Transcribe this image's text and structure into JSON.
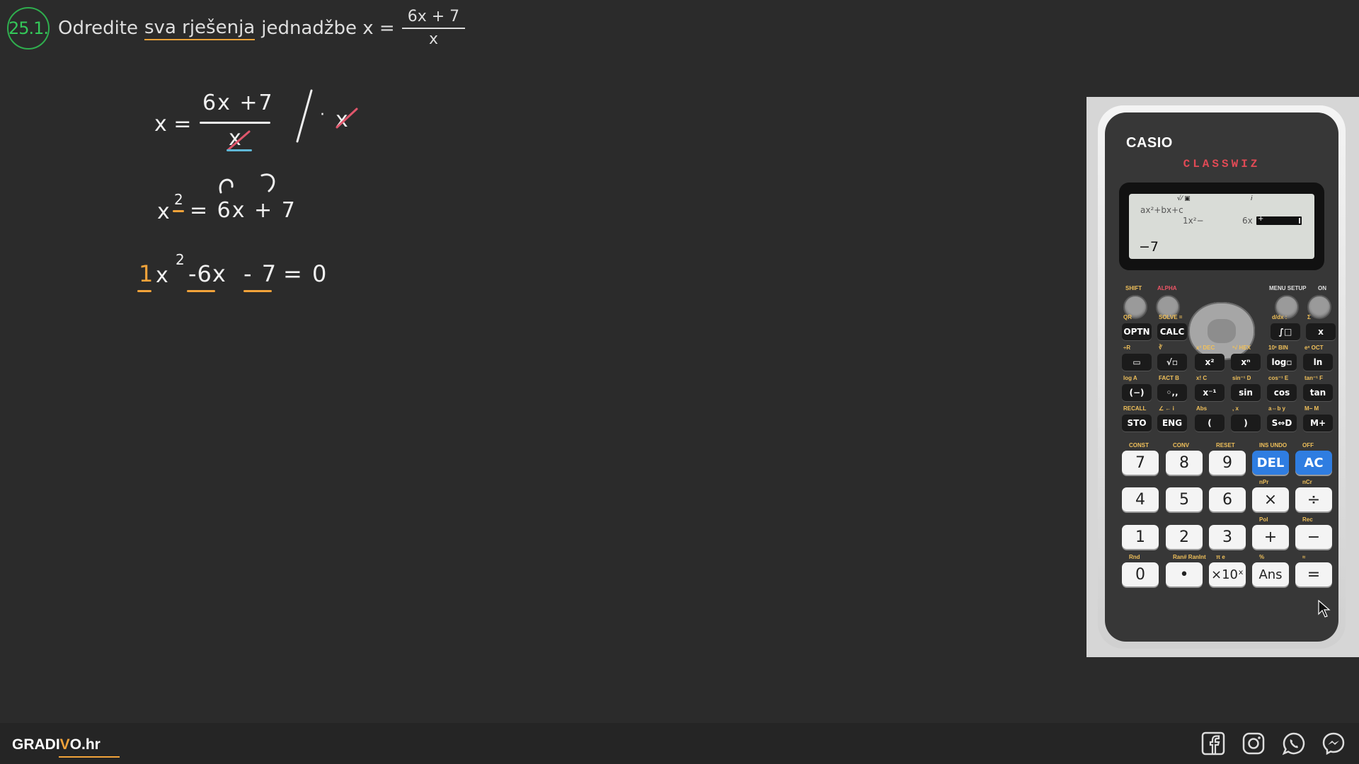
{
  "problem": {
    "number": "25.1.",
    "text_before": "Odredite",
    "text_highlight": "sva rješenja",
    "text_after": "jednadžbe x =",
    "fraction_numerator": "6x + 7",
    "fraction_denominator": "x"
  },
  "board": {
    "line1": {
      "lhs": "x =",
      "numerator": "6x +7",
      "denominator": "x",
      "operation": "/ ·",
      "op_factor": "x"
    },
    "line2": {
      "lhs": "x",
      "exponent": "2",
      "rhs": "= 6x + 7"
    },
    "line3": {
      "coef_a": "1",
      "var_a": "x",
      "exp_a": "2",
      "term_b": "-6x",
      "term_c": "- 7",
      "rhs": "= 0"
    }
  },
  "calculator": {
    "brand": "CASIO",
    "model": "CLASSWIZ",
    "display": {
      "indicators": "√⁄ ▣",
      "indicator2": "i",
      "equation": "ax²+bx+c",
      "coef_a": "1x²−",
      "coef_b": "6x",
      "result": "−7"
    },
    "top_labels": {
      "shift": "SHIFT",
      "alpha": "ALPHA",
      "menu_setup": "MENU SETUP",
      "on": "ON"
    },
    "fn_rows": [
      [
        {
          "top": "QR",
          "key": "OPTN"
        },
        {
          "top": "SOLVE =",
          "key": "CALC"
        },
        {
          "top": "d/dx :",
          "key": "∫□"
        },
        {
          "top": "Σ",
          "key": "x"
        }
      ],
      [
        {
          "top": "÷R",
          "key": "▭"
        },
        {
          "top": "∛",
          "key": "√▫"
        },
        {
          "top": "x³ DEC",
          "key": "x²"
        },
        {
          "top": "ˣ√ HEX",
          "key": "xⁿ"
        },
        {
          "top": "10ˣ BIN",
          "key": "log▫"
        },
        {
          "top": "eˣ OCT",
          "key": "ln"
        }
      ],
      [
        {
          "top": "log A",
          "key": "(−)"
        },
        {
          "top": "FACT B",
          "key": "◦‚‚"
        },
        {
          "top": "x! C",
          "key": "x⁻¹"
        },
        {
          "top": "sin⁻¹ D",
          "key": "sin"
        },
        {
          "top": "cos⁻¹ E",
          "key": "cos"
        },
        {
          "top": "tan⁻¹ F",
          "key": "tan"
        }
      ],
      [
        {
          "top": "RECALL",
          "key": "STO"
        },
        {
          "top": "∠ ← i",
          "key": "ENG"
        },
        {
          "top": "Abs",
          "key": "("
        },
        {
          "top": ", x",
          "key": ")"
        },
        {
          "top": "a⇔b y",
          "key": "S⇔D"
        },
        {
          "top": "M− M",
          "key": "M+"
        }
      ]
    ],
    "num_rows": [
      [
        {
          "top": "CONST",
          "key": "7"
        },
        {
          "top": "CONV",
          "key": "8"
        },
        {
          "top": "RESET",
          "key": "9"
        },
        {
          "top": "INS UNDO",
          "key": "DEL"
        },
        {
          "top": "OFF",
          "key": "AC"
        }
      ],
      [
        {
          "top": "",
          "key": "4"
        },
        {
          "top": "",
          "key": "5"
        },
        {
          "top": "",
          "key": "6"
        },
        {
          "top": "nPr",
          "key": "×"
        },
        {
          "top": "nCr",
          "key": "÷"
        }
      ],
      [
        {
          "top": "",
          "key": "1"
        },
        {
          "top": "",
          "key": "2"
        },
        {
          "top": "",
          "key": "3"
        },
        {
          "top": "Pol",
          "key": "+"
        },
        {
          "top": "Rec",
          "key": "−"
        }
      ],
      [
        {
          "top": "Rnd",
          "key": "0"
        },
        {
          "top": "Ran# RanInt",
          "key": "•"
        },
        {
          "top": "π e",
          "key": "×10ˣ"
        },
        {
          "top": "%",
          "key": "Ans"
        },
        {
          "top": "≈",
          "key": "="
        }
      ]
    ]
  },
  "footer": {
    "brand_main": "GRADI",
    "brand_accent": "V",
    "brand_rest": "O.hr",
    "social_icons": [
      "facebook-icon",
      "instagram-icon",
      "whatsapp-icon",
      "messenger-icon"
    ]
  }
}
